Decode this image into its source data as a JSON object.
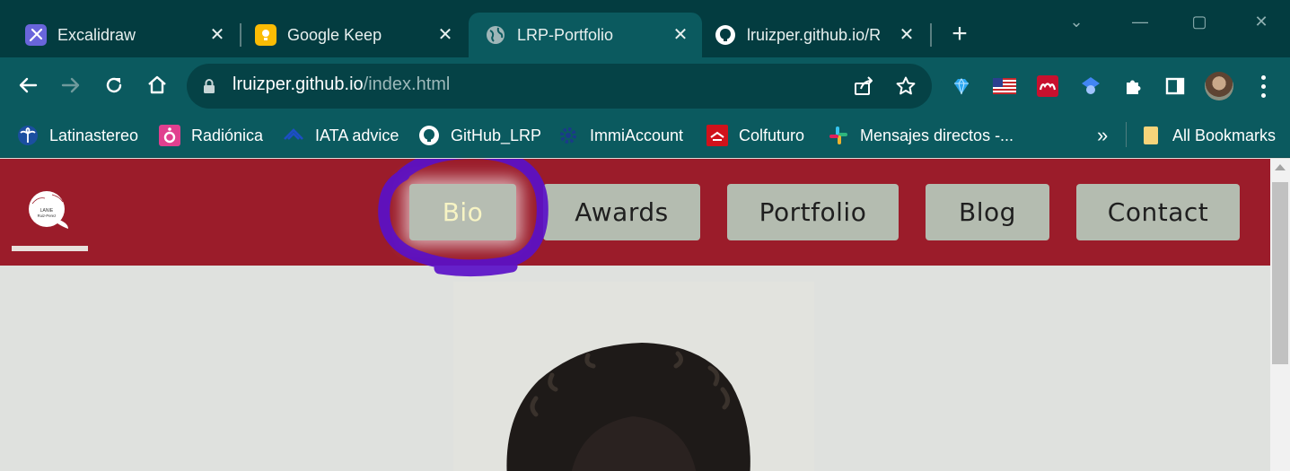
{
  "browser": {
    "tabs": [
      {
        "title": "Excalidraw",
        "icon": "excalidraw-icon",
        "color": "#6965db"
      },
      {
        "title": "Google Keep",
        "icon": "keep-icon",
        "color": "#fbbc04"
      },
      {
        "title": "LRP-Portfolio",
        "icon": "globe-icon",
        "active": true
      },
      {
        "title": "lruizper.github.io/R",
        "icon": "github-icon"
      }
    ],
    "close_glyph": "✕",
    "new_tab_glyph": "+",
    "window_controls": {
      "list": "⌄",
      "minimize": "—",
      "maximize": "▢",
      "close": "✕"
    },
    "url_host": "lruizper.github.io",
    "url_path": "/index.html",
    "bookmarks": [
      {
        "label": "Latinastereo",
        "icon": "palm-tree-icon"
      },
      {
        "label": "Radiónica",
        "icon": "radionica-icon"
      },
      {
        "label": "IATA advice",
        "icon": "iata-icon"
      },
      {
        "label": "GitHub_LRP",
        "icon": "github-icon"
      },
      {
        "label": "ImmiAccount",
        "icon": "gear-icon"
      },
      {
        "label": "Colfuturo",
        "icon": "colfuturo-icon"
      },
      {
        "label": "Mensajes directos -...",
        "icon": "slack-icon"
      }
    ],
    "bookmarks_overflow": "»",
    "all_bookmarks": "All Bookmarks"
  },
  "site": {
    "logo_line1": "LANIE",
    "logo_line2": "Ruiz-Perez",
    "nav": [
      {
        "label": "Bio",
        "active": true
      },
      {
        "label": "Awards"
      },
      {
        "label": "Portfolio"
      },
      {
        "label": "Blog"
      },
      {
        "label": "Contact"
      }
    ],
    "colors": {
      "header": "#9b1c2a",
      "nav_button": "#b4bcb0",
      "annotation": "#5a10c8",
      "page_bg": "#dfe1de"
    }
  }
}
